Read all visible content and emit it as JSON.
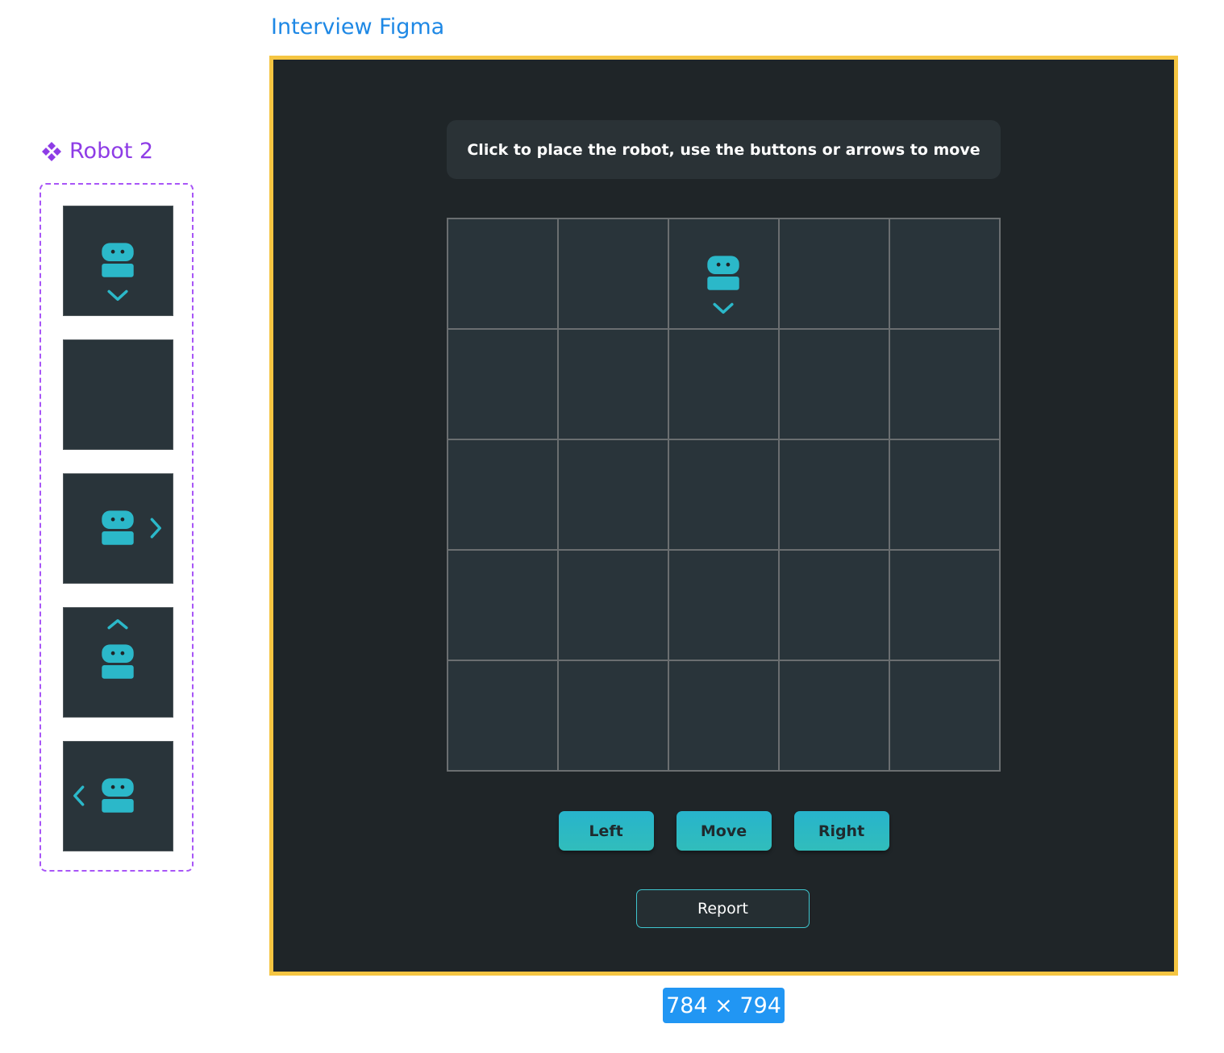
{
  "canvas": {
    "frame_title": "Interview Figma",
    "size_label": "784 × 794",
    "selection_color": "#f5c542",
    "component_color": "#8e3ce6"
  },
  "component": {
    "name": "Robot 2",
    "icon": "component-icon",
    "variants": [
      {
        "robot": true,
        "direction": "down"
      },
      {
        "robot": false,
        "direction": null
      },
      {
        "robot": true,
        "direction": "right"
      },
      {
        "robot": true,
        "direction": "up"
      },
      {
        "robot": true,
        "direction": "left"
      }
    ]
  },
  "app": {
    "instruction": "Click to place the robot, use the buttons or arrows to move",
    "grid": {
      "rows": 5,
      "cols": 5,
      "robot": {
        "row": 1,
        "col": 3,
        "direction": "down"
      }
    },
    "buttons": {
      "left": "Left",
      "move": "Move",
      "right": "Right",
      "report": "Report"
    },
    "colors": {
      "accent": "#2bb8c9",
      "background": "#1f2528",
      "cell": "#29343a"
    }
  }
}
